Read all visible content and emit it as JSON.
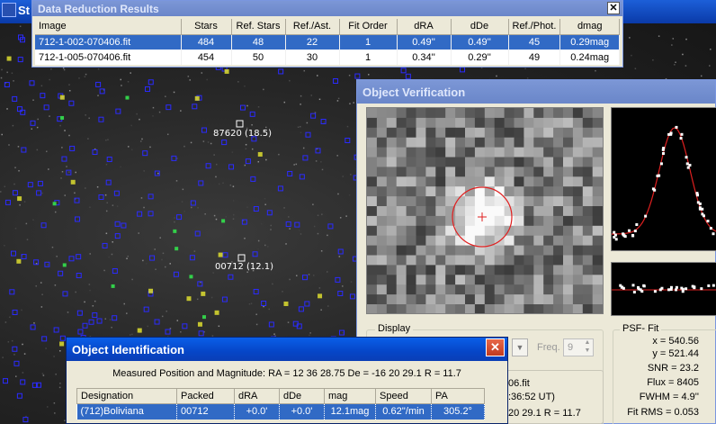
{
  "main_window": {
    "title": "St"
  },
  "starfield": {
    "labels": [
      {
        "text": "87620 (18.5)"
      },
      {
        "text": "00712 (12.1)"
      }
    ]
  },
  "data_reduction": {
    "title": "Data Reduction Results",
    "columns": [
      "Image",
      "Stars",
      "Ref. Stars",
      "Ref./Ast.",
      "Fit Order",
      "dRA",
      "dDe",
      "Ref./Phot.",
      "dmag"
    ],
    "rows": [
      {
        "image": "712-1-002-070406.fit",
        "stars": "484",
        "ref_stars": "48",
        "ref_ast": "22",
        "fit_order": "1",
        "dra": "0.49''",
        "dde": "0.49''",
        "ref_phot": "45",
        "dmag": "0.29mag",
        "selected": true
      },
      {
        "image": "712-1-005-070406.fit",
        "stars": "454",
        "ref_stars": "50",
        "ref_ast": "30",
        "fit_order": "1",
        "dra": "0.34''",
        "dde": "0.29''",
        "ref_phot": "49",
        "dmag": "0.24mag",
        "selected": false
      }
    ]
  },
  "object_verification": {
    "title": "Object Verification",
    "display_label": "Display",
    "freq_label": "Freq.",
    "freq_value": "9",
    "psf_fit": {
      "label": "PSF- Fit",
      "x": "x = 540.56",
      "y": "y = 521.44",
      "snr": "SNR = 23.2",
      "flux": "Flux = 8405",
      "fwhm": "FWHM = 4.9''",
      "fit_rms": "Fit RMS = 0.053"
    },
    "partial_texts": {
      "file": "06.fit",
      "time": ":36:52 UT)",
      "pos": "20 29.1  R = 11.7"
    }
  },
  "object_identification": {
    "title": "Object Identification",
    "measured": "Measured Position and Magnitude: RA = 12 36 28.75   De = -16 20 29.1   R = 11.7",
    "columns": [
      "Designation",
      "Packed",
      "dRA",
      "dDe",
      "mag",
      "Speed",
      "PA"
    ],
    "rows": [
      {
        "designation": "(712)Boliviana",
        "packed": "00712",
        "dra": "+0.0'",
        "dde": "+0.0'",
        "mag": "12.1mag",
        "speed": "0.62''/min",
        "pa": "305.2°"
      }
    ]
  },
  "colors": {
    "title_active": "#0646c8",
    "selection": "#316ac5",
    "marker_blue": "#2b2bff",
    "marker_yellow": "#e8e830",
    "psf_curve": "#e02020"
  }
}
